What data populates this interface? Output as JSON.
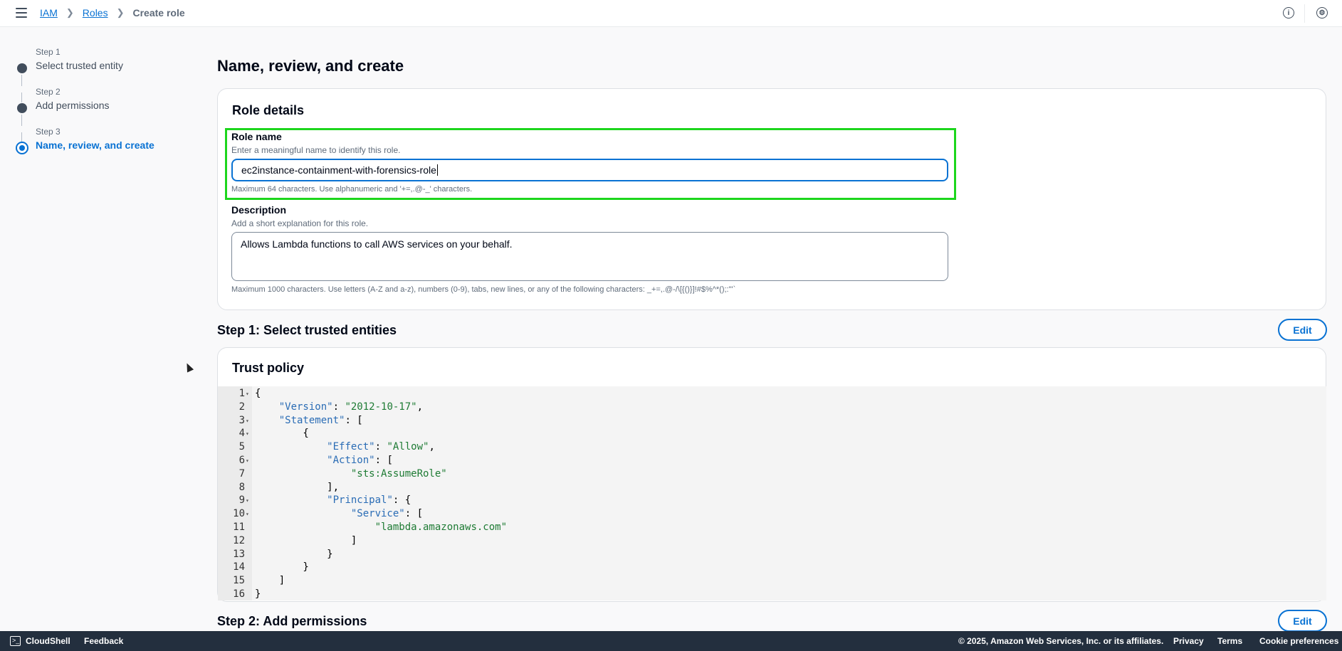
{
  "breadcrumb": {
    "items": [
      "IAM",
      "Roles"
    ],
    "current": "Create role"
  },
  "header": {
    "info_icon": "info-icon",
    "settings_icon": "settings-icon"
  },
  "wizard": {
    "steps": [
      {
        "num": "Step 1",
        "label": "Select trusted entity"
      },
      {
        "num": "Step 2",
        "label": "Add permissions"
      },
      {
        "num": "Step 3",
        "label": "Name, review, and create"
      }
    ]
  },
  "page": {
    "title": "Name, review, and create"
  },
  "role_details": {
    "title": "Role details",
    "role_name": {
      "label": "Role name",
      "desc": "Enter a meaningful name to identify this role.",
      "value": "ec2instance-containment-with-forensics-role",
      "constraint": "Maximum 64 characters. Use alphanumeric and '+=,.@-_' characters."
    },
    "description": {
      "label": "Description",
      "desc": "Add a short explanation for this role.",
      "value": "Allows Lambda functions to call AWS services on your behalf.",
      "constraint": "Maximum 1000 characters. Use letters (A-Z and a-z), numbers (0-9), tabs, new lines, or any of the following characters: _+=,.@-/\\[{()}]!#$%^*();:\"'`"
    }
  },
  "step1": {
    "title": "Step 1: Select trusted entities",
    "edit_label": "Edit"
  },
  "trust_policy": {
    "title": "Trust policy",
    "lines": [
      "{",
      "    \"Version\": \"2012-10-17\",",
      "    \"Statement\": [",
      "        {",
      "            \"Effect\": \"Allow\",",
      "            \"Action\": [",
      "                \"sts:AssumeRole\"",
      "            ],",
      "            \"Principal\": {",
      "                \"Service\": [",
      "                    \"lambda.amazonaws.com\"",
      "                ]",
      "            }",
      "        }",
      "    ]",
      "}"
    ],
    "line_numbers": [
      "1",
      "2",
      "3",
      "4",
      "5",
      "6",
      "7",
      "8",
      "9",
      "10",
      "11",
      "12",
      "13",
      "14",
      "15",
      "16"
    ]
  },
  "step2": {
    "title": "Step 2: Add permissions",
    "edit_label": "Edit"
  },
  "footer": {
    "cloudshell": "CloudShell",
    "feedback": "Feedback",
    "copyright": "© 2025, Amazon Web Services, Inc. or its affiliates.",
    "privacy": "Privacy",
    "terms": "Terms",
    "cookie": "Cookie preferences"
  }
}
